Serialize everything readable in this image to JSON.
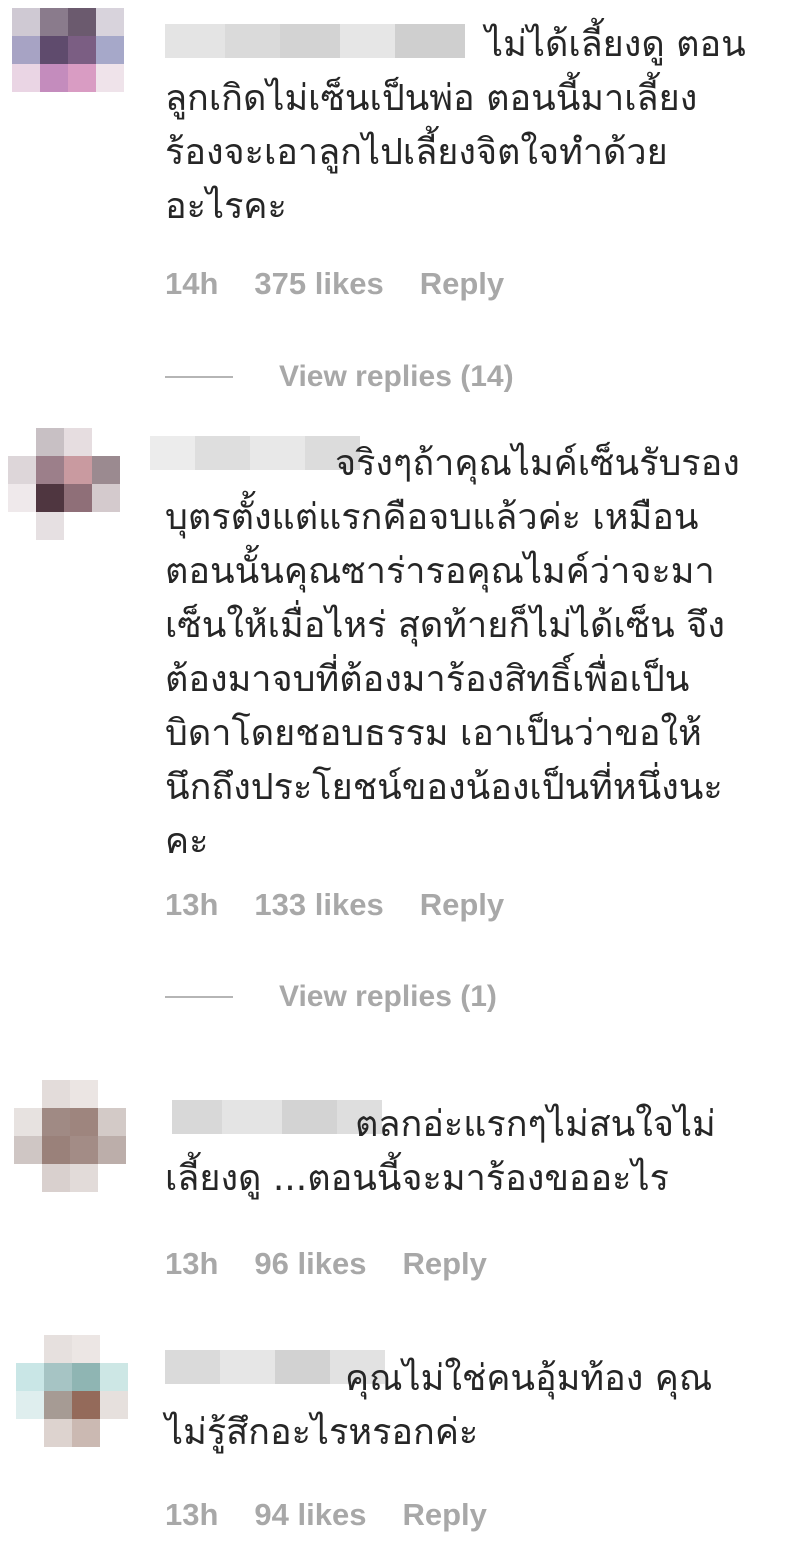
{
  "comments": [
    {
      "text": "ไม่ได้เลี้ยงดู ตอน\nลูกเกิดไม่เซ็นเป็นพ่อ ตอนนี้มาเลี้ยง\nร้องจะเอาลูกไปเลี้ยงจิตใจทำด้วย\nอะไรคะ",
      "time": "14h",
      "likes": "375 likes",
      "reply": "Reply",
      "view_replies": "View replies (14)"
    },
    {
      "text": "จริงๆถ้าคุณไมค์เซ็นรับรอง\nบุตรตั้งแต่แรกคือจบแล้วค่ะ เหมือน\nตอนนั้นคุณซาร่ารอคุณไมค์ว่าจะมา\nเซ็นให้เมื่อไหร่ สุดท้ายก็ไม่ได้เซ็น จึง\nต้องมาจบที่ต้องมาร้องสิทธิ์เพื่อเป็น\nบิดาโดยชอบธรรม เอาเป็นว่าขอให้\nนึกถึงประโยชน์ของน้องเป็นที่หนึ่งนะ\nคะ",
      "time": "13h",
      "likes": "133 likes",
      "reply": "Reply",
      "view_replies": "View replies (1)"
    },
    {
      "text": "ตลกอ่ะแรกๆไม่สนใจไม่\nเลี้ยงดู ...ตอนนี้จะมาร้องขออะไร",
      "time": "13h",
      "likes": "96 likes",
      "reply": "Reply"
    },
    {
      "text": "คุณไม่ใช่คนอุ้มท้อง คุณ\nไม่รู้สึกอะไรหรอกค่ะ",
      "time": "13h",
      "likes": "94 likes",
      "reply": "Reply"
    }
  ],
  "colors": {
    "text": "#262626",
    "meta": "#a8a8a8",
    "background": "#ffffff"
  }
}
